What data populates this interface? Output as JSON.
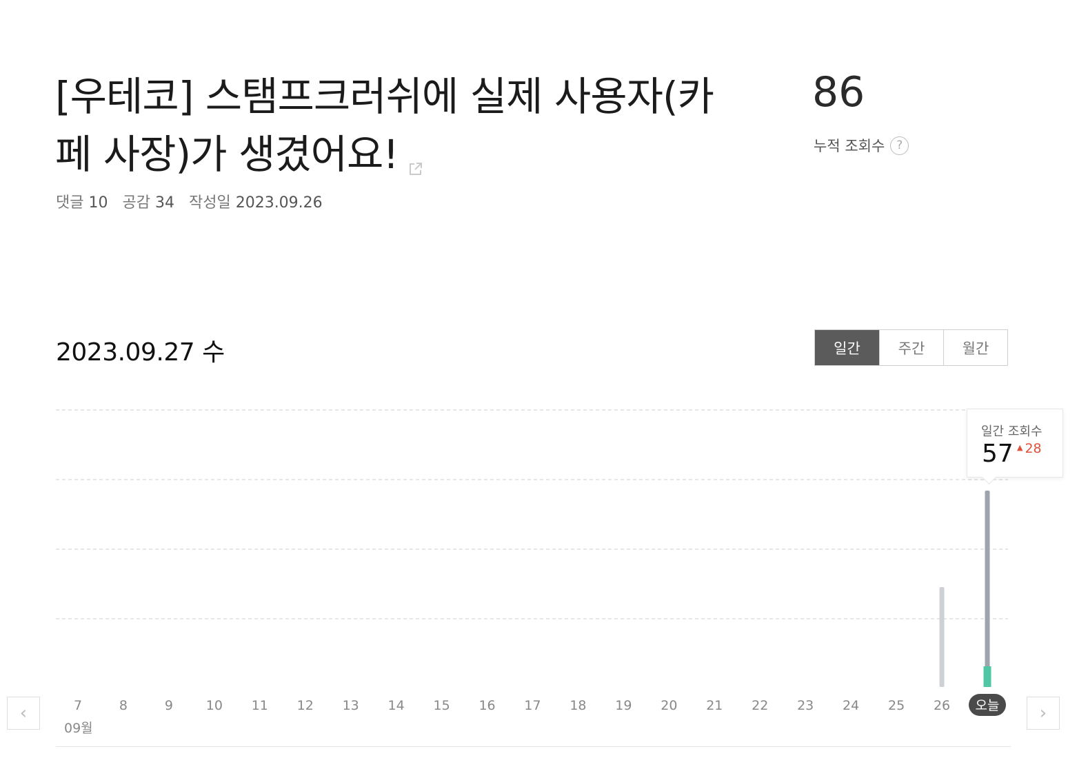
{
  "post": {
    "title": "[우테코] 스탬프크러쉬에 실제 사용자(카페 사장)가 생겼어요!",
    "external_link_icon": "external-link-icon",
    "comments_label": "댓글",
    "comments_count": "10",
    "likes_label": "공감",
    "likes_count": "34",
    "created_label": "작성일",
    "created_date": "2023.09.26"
  },
  "stats": {
    "total_views": "86",
    "total_views_label": "누적 조회수",
    "help_icon": "question-circle-icon",
    "help_glyph": "?"
  },
  "chart_header": {
    "date": "2023.09.27 수",
    "tabs": [
      {
        "label": "일간",
        "active": true
      },
      {
        "label": "주간",
        "active": false
      },
      {
        "label": "월간",
        "active": false
      }
    ]
  },
  "tooltip": {
    "label": "일간 조회수",
    "value": "57",
    "change": "28",
    "change_direction": "up"
  },
  "chart_data": {
    "type": "bar",
    "categories": [
      "7",
      "8",
      "9",
      "10",
      "11",
      "12",
      "13",
      "14",
      "15",
      "16",
      "17",
      "18",
      "19",
      "20",
      "21",
      "22",
      "23",
      "24",
      "25",
      "26",
      "오늘"
    ],
    "series": [
      {
        "values": [
          0,
          0,
          0,
          0,
          0,
          0,
          0,
          0,
          0,
          0,
          0,
          0,
          0,
          0,
          0,
          0,
          0,
          0,
          0,
          29,
          57
        ]
      }
    ],
    "highlight_segment": {
      "category": "오늘",
      "value": 6
    },
    "ylim": [
      0,
      80
    ],
    "grid": true,
    "month_label": "09월",
    "colors": {
      "bar": "#cdd1d6",
      "bar_today": "#9ea4ac",
      "bar_today_new": "#4fc6a4",
      "today_badge": "#4a4a4a",
      "grid": "#dddddd",
      "tick_text": "#888888"
    }
  },
  "nav": {
    "prev_icon": "chevron-left-icon",
    "next_icon": "chevron-right-icon",
    "prev_glyph": "‹",
    "next_glyph": "›"
  }
}
